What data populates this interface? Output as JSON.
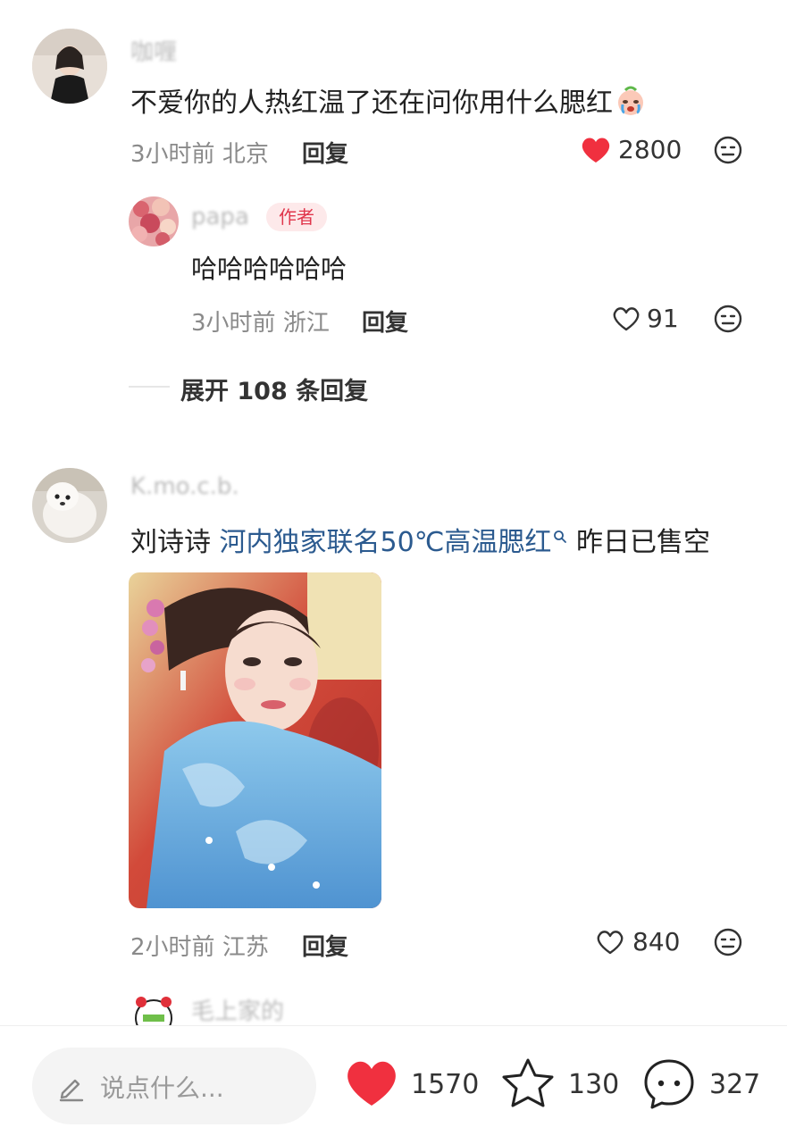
{
  "comment1": {
    "username": "咖喱",
    "text": "不爱你的人热红温了还在问你用什么腮红",
    "emoji": "crying-face-emoji",
    "time": "3小时前",
    "location": "北京",
    "reply_label": "回复",
    "likes": "2800",
    "liked": true
  },
  "reply1": {
    "username": "papa",
    "badge": "作者",
    "text": "哈哈哈哈哈哈",
    "time": "3小时前",
    "location": "浙江",
    "reply_label": "回复",
    "likes": "91"
  },
  "expand_replies": "展开 108 条回复",
  "comment2": {
    "username": "K.mo.c.b.",
    "text_prefix": "刘诗诗",
    "link_text": "河内独家联名50℃高温腮红",
    "text_suffix": "昨日已售空",
    "time": "2小时前",
    "location": "江苏",
    "reply_label": "回复",
    "likes": "840"
  },
  "comment3": {
    "username": "毛上家的"
  },
  "footer": {
    "input_placeholder": "说点什么...",
    "likes": "1570",
    "stars": "130",
    "comments": "327"
  },
  "colors": {
    "like_red": "#f0303f",
    "link_blue": "#2b5a8f",
    "muted_gray": "#8a8a8a"
  }
}
